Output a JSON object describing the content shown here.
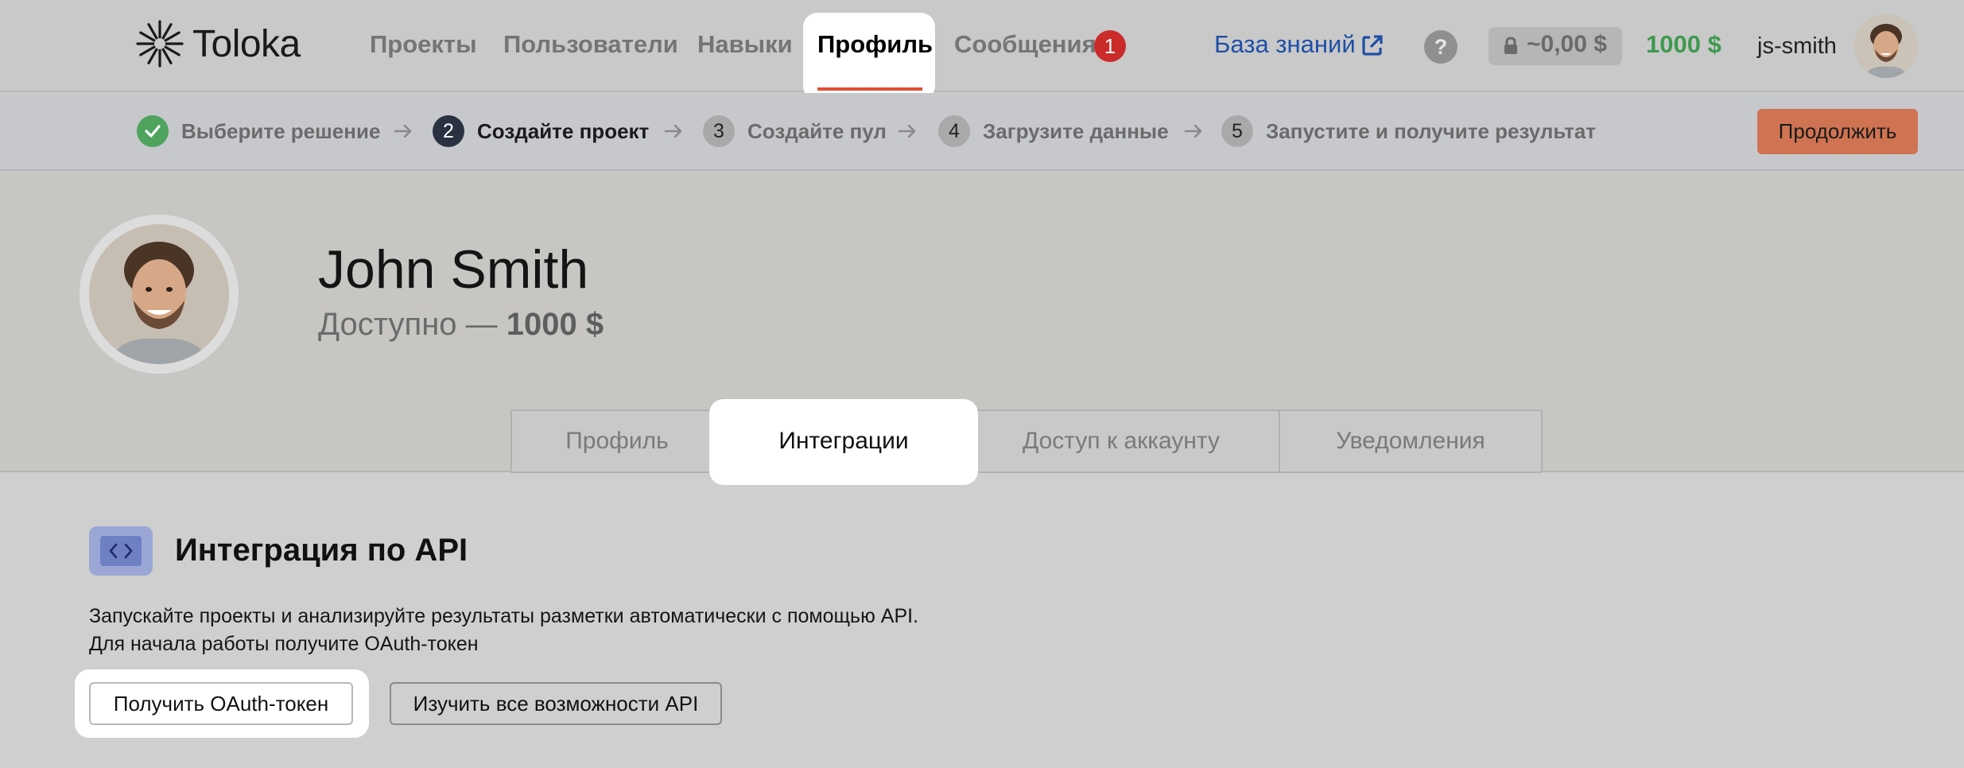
{
  "brand": {
    "name": "Toloka"
  },
  "nav": {
    "projects": "Проекты",
    "users": "Пользователи",
    "skills": "Навыки",
    "profile": "Профиль",
    "messages": "Сообщения",
    "messages_badge": "1",
    "knowledge_base": "База знаний",
    "help": "?",
    "locked_balance": "~0,00 $",
    "balance": "1000 $",
    "username": "js-smith"
  },
  "steps": [
    {
      "number": "✓",
      "label": "Выберите решение",
      "state": "done"
    },
    {
      "number": "2",
      "label": "Создайте проект",
      "state": "active"
    },
    {
      "number": "3",
      "label": "Создайте пул",
      "state": "todo"
    },
    {
      "number": "4",
      "label": "Загрузите данные",
      "state": "todo"
    },
    {
      "number": "5",
      "label": "Запустите и получите результат",
      "state": "todo"
    }
  ],
  "continue_label": "Продолжить",
  "profile": {
    "name": "John Smith",
    "available_prefix": "Доступно —",
    "available_amount": "1000 $"
  },
  "tabs": [
    "Профиль",
    "Интеграции",
    "Доступ к аккаунту",
    "Уведомления"
  ],
  "api": {
    "title": "Интеграция по API",
    "desc_line1": "Запускайте проекты и анализируйте результаты разметки автоматически с помощью API.",
    "desc_line2": "Для начала работы получите OAuth-токен",
    "oauth_button": "Получить OAuth-токен",
    "explore_button": "Изучить все возможности API"
  },
  "colors": {
    "accent_underline": "#e34c33",
    "badge_red": "#cc2b2b",
    "link_blue": "#1f4fa7",
    "money_green": "#3f9a4f",
    "continue_button": "#cf7352",
    "step_done": "#4ea35d",
    "step_active": "#2a3140"
  }
}
